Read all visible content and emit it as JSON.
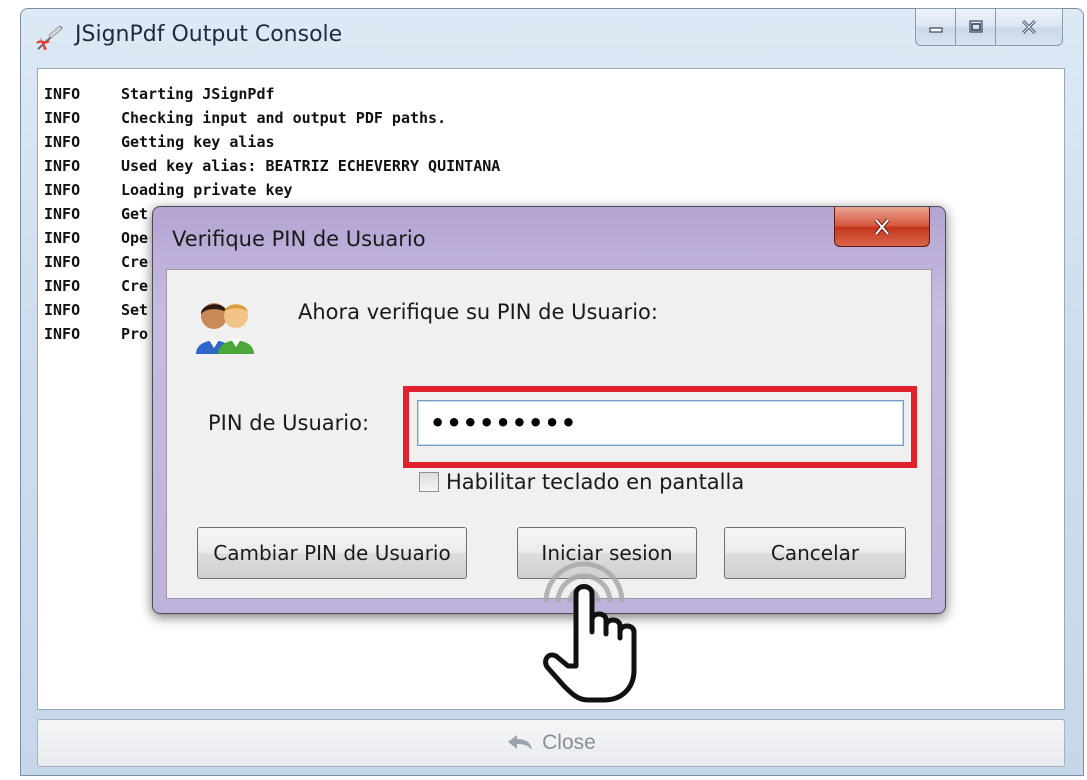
{
  "outer_window": {
    "title": "JSignPdf Output Console",
    "console_lines": [
      {
        "level": "INFO",
        "message": "Starting JSignPdf"
      },
      {
        "level": "INFO",
        "message": "Checking input and output PDF paths."
      },
      {
        "level": "INFO",
        "message": "Getting key alias"
      },
      {
        "level": "INFO",
        "message": "Used key alias: BEATRIZ ECHEVERRY QUINTANA"
      },
      {
        "level": "INFO",
        "message": "Loading private key"
      },
      {
        "level": "INFO",
        "message": "Get"
      },
      {
        "level": "INFO",
        "message": "Ope"
      },
      {
        "level": "INFO",
        "message": "Cre"
      },
      {
        "level": "INFO",
        "message": "Cre"
      },
      {
        "level": "INFO",
        "message": "Set"
      },
      {
        "level": "INFO",
        "message": "Pro"
      }
    ],
    "close_button_label": "Close"
  },
  "pin_dialog": {
    "title": "Verifique PIN de Usuario",
    "prompt": "Ahora verifique su PIN de Usuario:",
    "pin_label": "PIN de Usuario:",
    "pin_value": "•••••••••",
    "onscreen_keyboard_label": "Habilitar teclado en pantalla",
    "onscreen_keyboard_checked": false,
    "buttons": {
      "change_pin": "Cambiar PIN de Usuario",
      "login": "Iniciar sesion",
      "cancel": "Cancelar"
    }
  },
  "colors": {
    "highlight": "#e0212e",
    "dialog_frame": "#bfb3db",
    "window_frame": "#cfdeee"
  },
  "icons": [
    "jsignpdf-app-icon",
    "minimize-icon",
    "maximize-icon",
    "close-icon",
    "users-icon",
    "back-arrow-icon",
    "hand-pointer-icon"
  ]
}
